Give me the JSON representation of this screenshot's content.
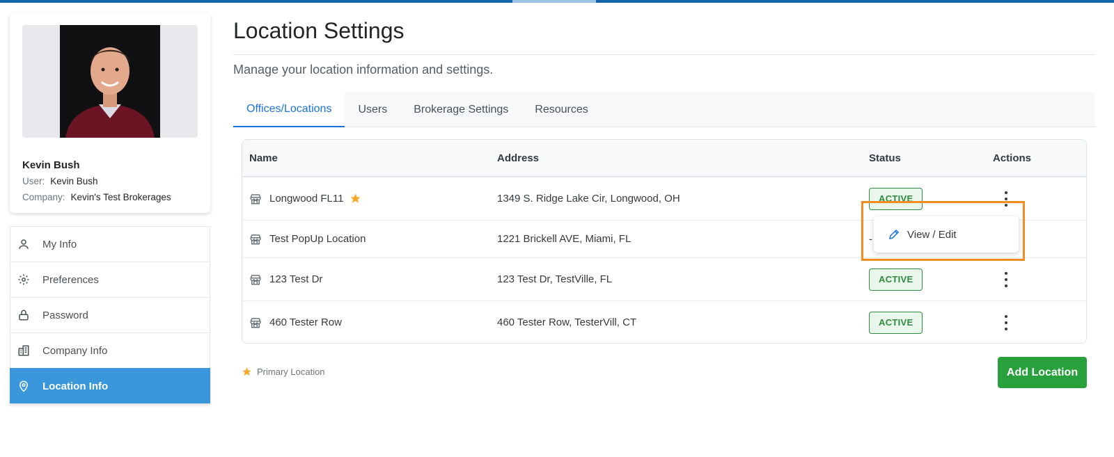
{
  "profile": {
    "name": "Kevin Bush",
    "user_label": "User:",
    "user_value": "Kevin Bush",
    "company_label": "Company:",
    "company_value": "Kevin's Test Brokerages"
  },
  "side_menu": [
    {
      "label": "My Info",
      "icon": "person-icon",
      "active": false
    },
    {
      "label": "Preferences",
      "icon": "gear-icon",
      "active": false
    },
    {
      "label": "Password",
      "icon": "lock-icon",
      "active": false
    },
    {
      "label": "Company Info",
      "icon": "building-icon",
      "active": false
    },
    {
      "label": "Location Info",
      "icon": "map-pin-icon",
      "active": true
    }
  ],
  "page": {
    "title": "Location Settings",
    "subtitle": "Manage your location information and settings."
  },
  "tabs": [
    {
      "label": "Offices/Locations",
      "active": true
    },
    {
      "label": "Users",
      "active": false
    },
    {
      "label": "Brokerage Settings",
      "active": false
    },
    {
      "label": "Resources",
      "active": false
    }
  ],
  "table": {
    "headers": {
      "name": "Name",
      "address": "Address",
      "status": "Status",
      "actions": "Actions"
    },
    "rows": [
      {
        "name": "Longwood FL11",
        "primary": true,
        "address": "1349 S. Ridge Lake Cir, Longwood, OH",
        "status": "ACTIVE"
      },
      {
        "name": "Test PopUp Location",
        "primary": false,
        "address": "1221 Brickell AVE, Miami, FL",
        "status": "-"
      },
      {
        "name": "123 Test Dr",
        "primary": false,
        "address": "123 Test Dr, TestVille, FL",
        "status": "ACTIVE"
      },
      {
        "name": "460 Tester Row",
        "primary": false,
        "address": "460 Tester Row, TesterVill, CT",
        "status": "ACTIVE"
      }
    ]
  },
  "dropdown": {
    "item_label": "View / Edit"
  },
  "legend": {
    "label": "Primary Location"
  },
  "add_button": {
    "label": "Add Location"
  },
  "colors": {
    "accent": "#1a73d9",
    "menu_active": "#3a97dc",
    "success": "#28a03c",
    "star": "#f5a623",
    "highlight": "#f28c1e"
  }
}
